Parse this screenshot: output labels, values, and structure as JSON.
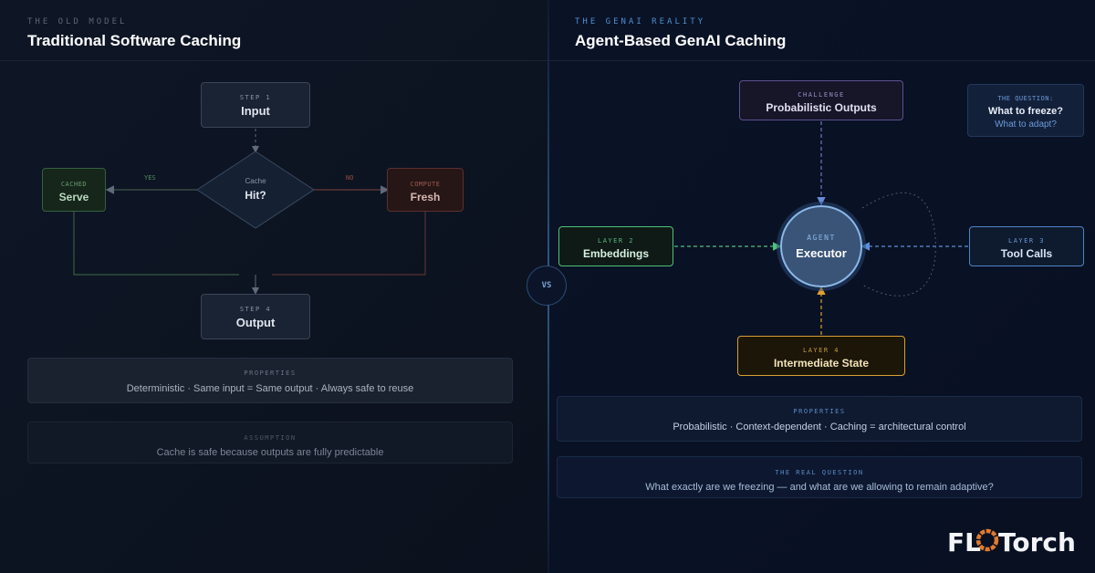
{
  "left": {
    "eyebrow": "THE OLD MODEL",
    "title": "Traditional Software Caching",
    "step1": {
      "small": "STEP 1",
      "label": "Input"
    },
    "decision": {
      "small": "Cache",
      "label": "Hit?"
    },
    "yes_label": "YES",
    "no_label": "NO",
    "cached": {
      "small": "CACHED",
      "label": "Serve"
    },
    "compute": {
      "small": "COMPUTE",
      "label": "Fresh"
    },
    "step4": {
      "small": "STEP 4",
      "label": "Output"
    },
    "properties": {
      "heading": "PROPERTIES",
      "text": "Deterministic · Same input = Same output · Always safe to reuse"
    },
    "assumption": {
      "heading": "ASSUMPTION",
      "text": "Cache is safe because outputs are fully predictable"
    }
  },
  "center": {
    "vs": "VS"
  },
  "right": {
    "eyebrow": "THE GENAI REALITY",
    "title": "Agent-Based GenAI Caching",
    "challenge": {
      "small": "CHALLENGE",
      "label": "Probabilistic Outputs"
    },
    "question": {
      "small": "THE QUESTION:",
      "line1": "What to freeze?",
      "line2": "What to adapt?"
    },
    "agent": {
      "small": "AGENT",
      "label": "Executor"
    },
    "layer2": {
      "small": "LAYER 2",
      "label": "Embeddings"
    },
    "layer3": {
      "small": "LAYER 3",
      "label": "Tool Calls"
    },
    "layer4": {
      "small": "LAYER 4",
      "label": "Intermediate State"
    },
    "properties": {
      "heading": "PROPERTIES",
      "text": "Probabilistic · Context-dependent · Caching = architectural control"
    },
    "real_question": {
      "heading": "THE REAL QUESTION",
      "text": "What exactly are we freezing — and what are we allowing to remain adaptive?"
    }
  },
  "brand": {
    "name": "FLOTorch",
    "accent": "#e07a2e"
  },
  "colors": {
    "green": "#4fc07a",
    "red": "#b94a3e",
    "blue": "#5b8fd8",
    "purple": "#7a6bb8",
    "orange": "#e0a030"
  }
}
